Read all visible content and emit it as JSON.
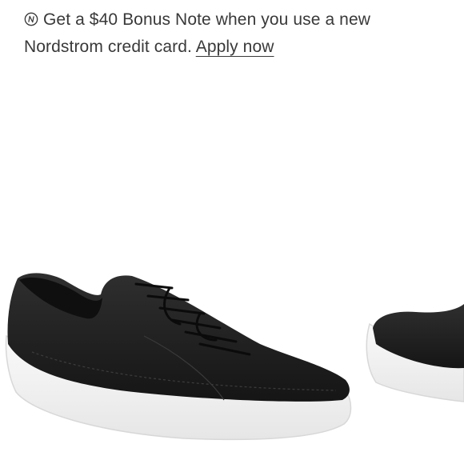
{
  "promo": {
    "badge_icon": "nordstrom-n-icon",
    "line1": "Get a $40 Bonus Note when you use a new",
    "line2_prefix": "Nordstrom credit card.",
    "apply_link": "Apply now"
  },
  "images": [
    {
      "name": "black leather low-top sneaker",
      "icon": "sneaker-main"
    },
    {
      "name": "black leather sneaker (partial)",
      "icon": "sneaker-partial"
    }
  ],
  "colors": {
    "text": "#393939",
    "upper": "#1e1e1e",
    "sole": "#f4f4f4",
    "background": "#ffffff"
  }
}
